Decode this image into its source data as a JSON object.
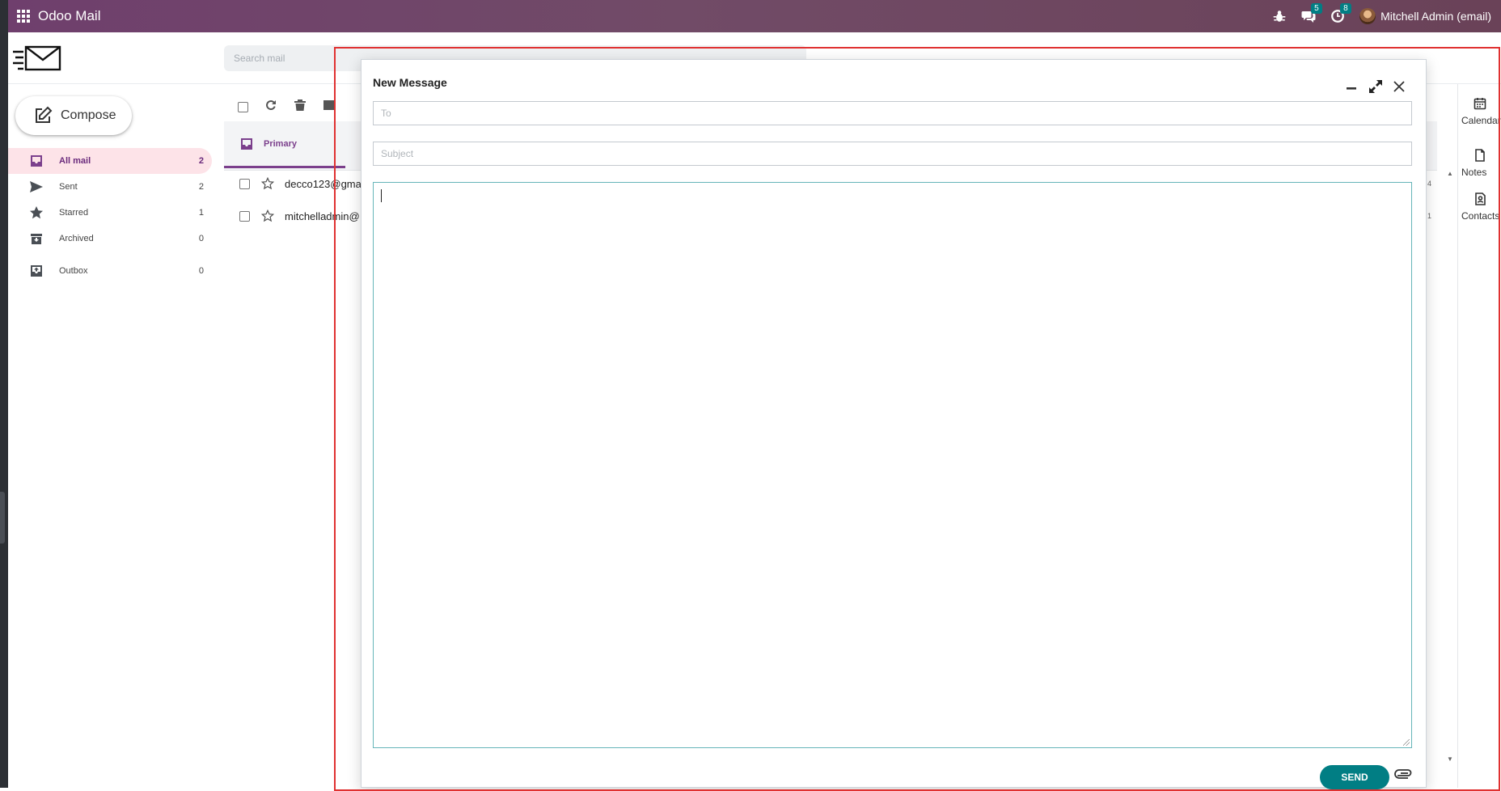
{
  "navbar": {
    "app_title": "Odoo Mail",
    "messages_badge": "5",
    "activities_badge": "8",
    "user_name": "Mitchell Admin (email)"
  },
  "search": {
    "placeholder": "Search mail"
  },
  "sidebar": {
    "compose_label": "Compose",
    "items": [
      {
        "label": "All mail",
        "count": "2",
        "icon": "inbox-icon",
        "active": true
      },
      {
        "label": "Sent",
        "count": "2",
        "icon": "send-icon"
      },
      {
        "label": "Starred",
        "count": "1",
        "icon": "star-icon"
      },
      {
        "label": "Archived",
        "count": "0",
        "icon": "archive-icon"
      },
      {
        "label": "Outbox",
        "count": "0",
        "icon": "outbox-icon"
      }
    ]
  },
  "list": {
    "tab_primary": "Primary",
    "rows": [
      {
        "sender": "decco123@gma",
        "count": "4"
      },
      {
        "sender": "mitchelladmin@",
        "count": "1"
      }
    ]
  },
  "right_panel": {
    "items": [
      {
        "label": "Calendar",
        "icon": "calendar-icon"
      },
      {
        "label": "Notes",
        "icon": "note-icon"
      },
      {
        "label": "Contacts",
        "icon": "contact-icon"
      }
    ]
  },
  "compose_dialog": {
    "title": "New Message",
    "to_placeholder": "To",
    "subject_placeholder": "Subject",
    "send_label": "SEND"
  },
  "colors": {
    "navbar": "#714b67",
    "accent_purple": "#7b3f8c",
    "teal": "#017e84",
    "active_bg": "#fde3e8",
    "overlay_outline": "#e03131"
  }
}
